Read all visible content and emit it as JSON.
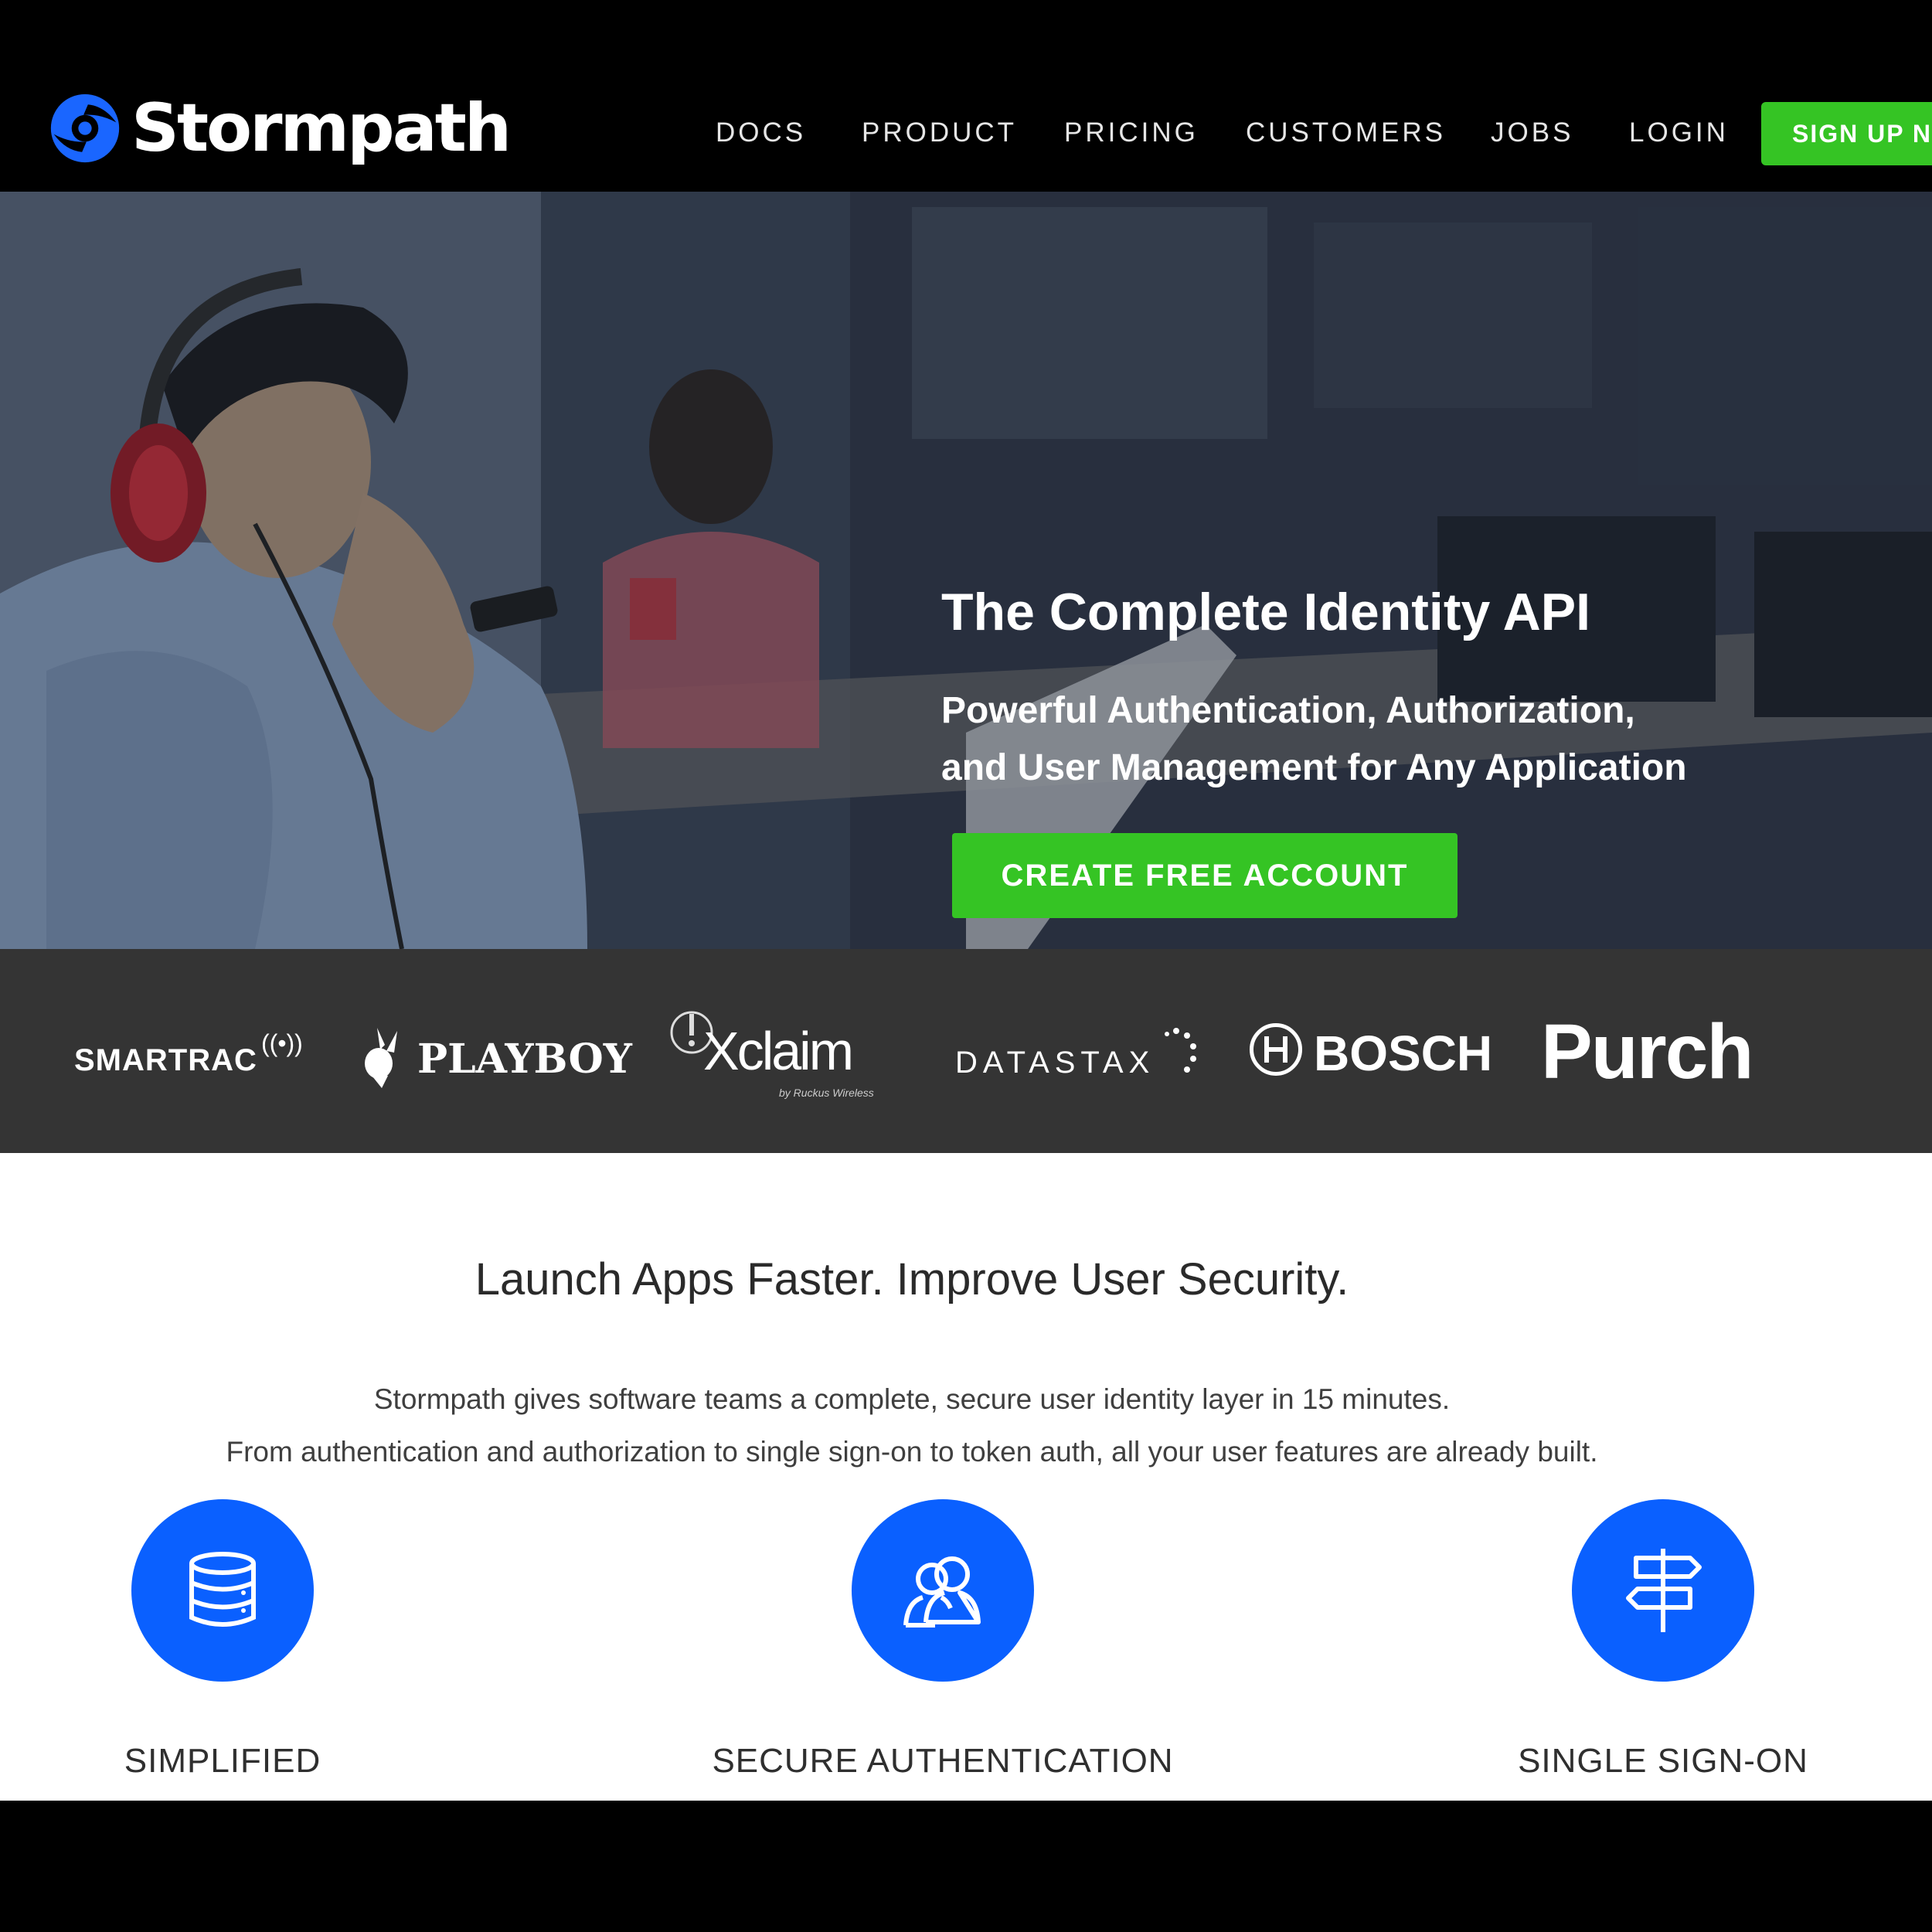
{
  "brand": {
    "name": "Stormpath"
  },
  "nav": {
    "items": [
      "DOCS",
      "PRODUCT",
      "PRICING",
      "CUSTOMERS",
      "JOBS",
      "LOGIN"
    ],
    "signup_label": "SIGN UP N"
  },
  "hero": {
    "title": "The Complete Identity API",
    "subtitle_line1": "Powerful Authentication, Authorization,",
    "subtitle_line2": "and User Management for Any Application",
    "cta_label": "CREATE FREE ACCOUNT"
  },
  "customers": {
    "logos": {
      "smartrac": "SMARTRAC",
      "playboy": "PLAYBOY",
      "xclaim": "Xclaim",
      "xclaim_sub": "by Ruckus Wireless",
      "datastax": "DATASTAX",
      "bosch": "BOSCH",
      "purch": "Purch"
    }
  },
  "intro": {
    "heading": "Launch Apps Faster. Improve User Security.",
    "paragraph_line1": "Stormpath gives software teams a complete, secure user identity layer in 15 minutes.",
    "paragraph_line2": "From authentication and authorization to single sign-on to token auth, all your user features are already built."
  },
  "features": [
    {
      "label": "SIMPLIFIED",
      "icon": "database-icon"
    },
    {
      "label": "SECURE AUTHENTICATION",
      "icon": "users-icon"
    },
    {
      "label": "SINGLE SIGN-ON",
      "icon": "signpost-icon"
    }
  ],
  "colors": {
    "accent_green": "#35c424",
    "accent_blue": "#0a60ff",
    "logo_strip": "#343434",
    "nav_bg": "#000000"
  }
}
